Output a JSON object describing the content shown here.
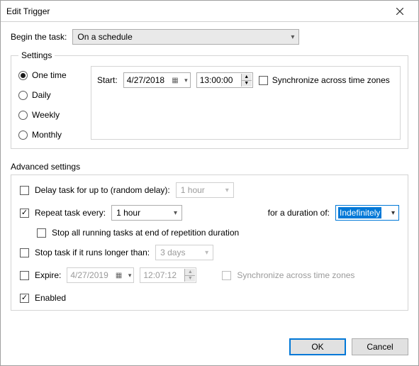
{
  "window": {
    "title": "Edit Trigger"
  },
  "begin": {
    "label": "Begin the task:",
    "value": "On a schedule"
  },
  "settings": {
    "legend": "Settings",
    "radios": {
      "one_time": "One time",
      "daily": "Daily",
      "weekly": "Weekly",
      "monthly": "Monthly"
    },
    "start_label": "Start:",
    "start_date": "4/27/2018",
    "start_time": "13:00:00",
    "sync_label": "Synchronize across time zones"
  },
  "advanced": {
    "legend": "Advanced settings",
    "delay_label": "Delay task for up to (random delay):",
    "delay_value": "1 hour",
    "repeat_label": "Repeat task every:",
    "repeat_value": "1 hour",
    "duration_label": "for a duration of:",
    "duration_value": "Indefinitely",
    "stop_all_label": "Stop all running tasks at end of repetition duration",
    "stop_if_label": "Stop task if it runs longer than:",
    "stop_if_value": "3 days",
    "expire_label": "Expire:",
    "expire_date": "4/27/2019",
    "expire_time": "12:07:12",
    "expire_sync_label": "Synchronize across time zones",
    "enabled_label": "Enabled"
  },
  "buttons": {
    "ok": "OK",
    "cancel": "Cancel"
  }
}
